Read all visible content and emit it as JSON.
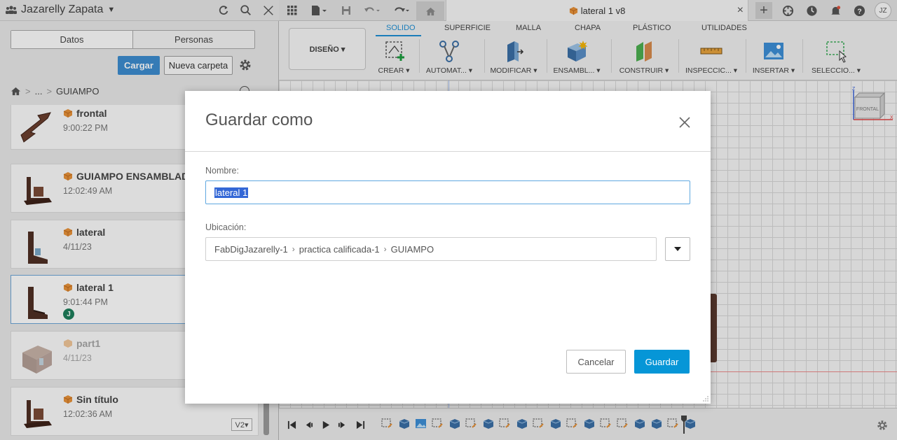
{
  "data_panel": {
    "user_name": "Jazarelly Zapata",
    "tabs": [
      "Datos",
      "Personas"
    ],
    "upload_label": "Cargar",
    "new_folder_label": "Nueva carpeta",
    "breadcrumb": {
      "ellipsis": "...",
      "current": "GUIAMPO"
    },
    "files": [
      {
        "name": "frontal",
        "time": "9:00:22 PM"
      },
      {
        "name": "GUIAMPO ENSAMBLADO",
        "time": "12:02:49 AM"
      },
      {
        "name": "lateral",
        "time": "4/11/23"
      },
      {
        "name": "lateral 1",
        "time": "9:01:44 PM",
        "avatar": "J"
      },
      {
        "name": "part1",
        "time": "4/11/23"
      },
      {
        "name": "Sin título",
        "time": "12:02:36 AM",
        "version": "V2▾"
      }
    ]
  },
  "app_bar": {
    "document_title": "lateral 1 v8",
    "user_initials": "JZ"
  },
  "ribbon": {
    "workspace_label": "DISEÑO ▾",
    "tabs": [
      "SOLIDO",
      "SUPERFICIE",
      "MALLA",
      "CHAPA",
      "PLÁSTICO",
      "UTILIDADES"
    ],
    "groups": [
      "CREAR ▾",
      "AUTOMAT... ▾",
      "MODIFICAR ▾",
      "ENSAMBL... ▾",
      "CONSTRUIR ▾",
      "INSPECCIC... ▾",
      "INSERTAR ▾",
      "SELECCIO... ▾"
    ]
  },
  "viewcube": {
    "face_label": "FRONTAL",
    "axis_z": "Z",
    "axis_x": "X"
  },
  "dialog": {
    "title": "Guardar como",
    "name_label": "Nombre:",
    "name_value": "lateral 1",
    "location_label": "Ubicación:",
    "location_path": [
      "FabDigJazarelly-1",
      "practica calificada-1",
      "GUIAMPO"
    ],
    "cancel_label": "Cancelar",
    "save_label": "Guardar"
  },
  "colors": {
    "accent_blue": "#0696d7",
    "upload_blue": "#3d8dd0",
    "tab_active": "#1e8fd4",
    "model_brown": "#5a3a2e",
    "cube_orange": "#e8923a"
  }
}
